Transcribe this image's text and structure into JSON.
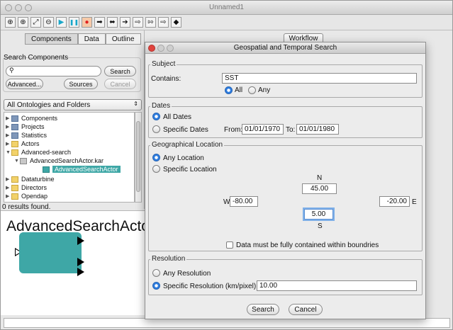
{
  "window": {
    "title": "Unnamed1"
  },
  "toolbar": {
    "buttons": [
      {
        "name": "zoom-in-icon",
        "glyph": "⊕"
      },
      {
        "name": "zoom-reset-icon",
        "glyph": "⊕"
      },
      {
        "name": "zoom-fit-icon",
        "glyph": "⤢"
      },
      {
        "name": "zoom-out-icon",
        "glyph": "⊖"
      },
      {
        "name": "run-icon",
        "glyph": "▶"
      },
      {
        "name": "pause-icon",
        "glyph": "❚❚"
      },
      {
        "name": "stop-icon",
        "glyph": "●"
      },
      {
        "name": "add-port-icon",
        "glyph": "➡"
      },
      {
        "name": "add-relation-icon",
        "glyph": "⬌"
      },
      {
        "name": "add-input-icon",
        "glyph": "➔"
      },
      {
        "name": "add-output-icon",
        "glyph": "⇨"
      },
      {
        "name": "add-io-icon",
        "glyph": "⇰"
      },
      {
        "name": "add-multiport-icon",
        "glyph": "⇨"
      },
      {
        "name": "add-vertex-icon",
        "glyph": "◆"
      }
    ]
  },
  "left_panel": {
    "tabs": [
      "Components",
      "Data",
      "Outline"
    ],
    "search_group_label": "Search Components",
    "search_value": "",
    "search_button": "Search",
    "advanced_button": "Advanced...",
    "sources_button": "Sources",
    "cancel_button": "Cancel",
    "ontology_select": "All Ontologies and Folders",
    "tree": [
      {
        "label": "Components",
        "icon": "comp",
        "indent": 0,
        "expanded": false
      },
      {
        "label": "Projects",
        "icon": "comp",
        "indent": 0,
        "expanded": false
      },
      {
        "label": "Statistics",
        "icon": "comp",
        "indent": 0,
        "expanded": false
      },
      {
        "label": "Actors",
        "icon": "folder",
        "indent": 0,
        "expanded": false
      },
      {
        "label": "Advanced-search",
        "icon": "folder",
        "indent": 0,
        "expanded": true
      },
      {
        "label": "AdvancedSearchActor.kar",
        "icon": "kar",
        "indent": 1,
        "expanded": true
      },
      {
        "label": "AdvancedSearchActor",
        "icon": "actor",
        "indent": 2,
        "selected": true
      },
      {
        "label": "Dataturbine",
        "icon": "folder",
        "indent": 0,
        "expanded": false
      },
      {
        "label": "Directors",
        "icon": "folder",
        "indent": 0,
        "expanded": false
      },
      {
        "label": "Opendap",
        "icon": "folder",
        "indent": 0,
        "expanded": false
      }
    ],
    "status": "0 results found."
  },
  "canvas": {
    "actor_label": "AdvancedSearchActo"
  },
  "workflow_tab": "Workflow",
  "dialog": {
    "title": "Geospatial and Temporal Search",
    "subject": {
      "legend": "Subject",
      "contains_label": "Contains:",
      "contains_value": "SST",
      "all_label": "All",
      "any_label": "Any",
      "selected": "All"
    },
    "dates": {
      "legend": "Dates",
      "all_dates_label": "All Dates",
      "specific_dates_label": "Specific Dates",
      "from_label": "From:",
      "from_value": "01/01/1970",
      "to_label": "To:",
      "to_value": "01/01/1980",
      "selected": "All Dates"
    },
    "location": {
      "legend": "Geographical Location",
      "any_location_label": "Any Location",
      "specific_location_label": "Specific Location",
      "selected": "Any Location",
      "north_label": "N",
      "north_value": "45.00",
      "west_label": "W",
      "west_value": "-80.00",
      "east_label": "E",
      "east_value": "-20.00",
      "south_label": "S",
      "south_value": "5.00",
      "contained_label": "Data must be fully contained within boundries",
      "contained_checked": false
    },
    "resolution": {
      "legend": "Resolution",
      "any_label": "Any Resolution",
      "specific_label": "Specific Resolution (km/pixel)",
      "specific_value": "10.00",
      "selected": "Specific Resolution"
    },
    "search_button": "Search",
    "cancel_button": "Cancel"
  }
}
